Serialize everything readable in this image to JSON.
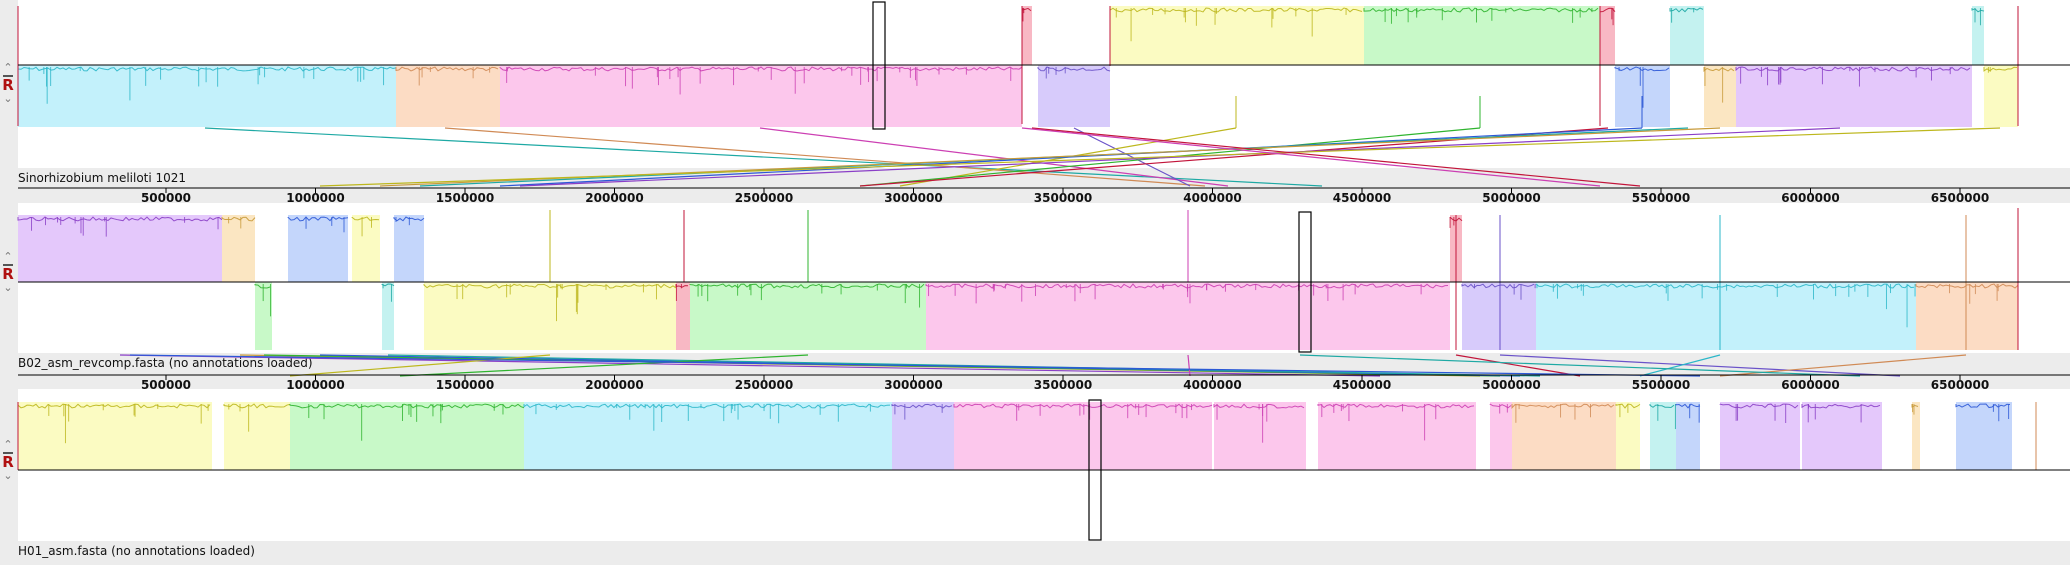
{
  "genomes": [
    {
      "name": "Sinorhizobium meliloti 1021"
    },
    {
      "name": "B02_asm_revcomp.fasta (no annotations loaded)"
    },
    {
      "name": "H01_asm.fasta (no annotations loaded)"
    }
  ],
  "ruler": {
    "ticks": [
      "500000",
      "1000000",
      "1500000",
      "2000000",
      "2500000",
      "3000000",
      "3500000",
      "4000000",
      "4500000",
      "5000000",
      "5500000",
      "6000000",
      "6500000"
    ]
  },
  "controls": {
    "up": "⌃",
    "reverse": "R",
    "down": "⌄"
  },
  "colors": {
    "cyan": "#c3f1fb",
    "orange": "#fcdcc4",
    "pink": "#fcc7ec",
    "lavender": "#d7cbfb",
    "yellow": "#fbfbc2",
    "green": "#c8f9c8",
    "red": "#f8b8c4",
    "blue": "#c4d6fb",
    "violet": "#e4c8fb",
    "tan": "#fbe6c2",
    "teal": "#c4f2f0"
  }
}
